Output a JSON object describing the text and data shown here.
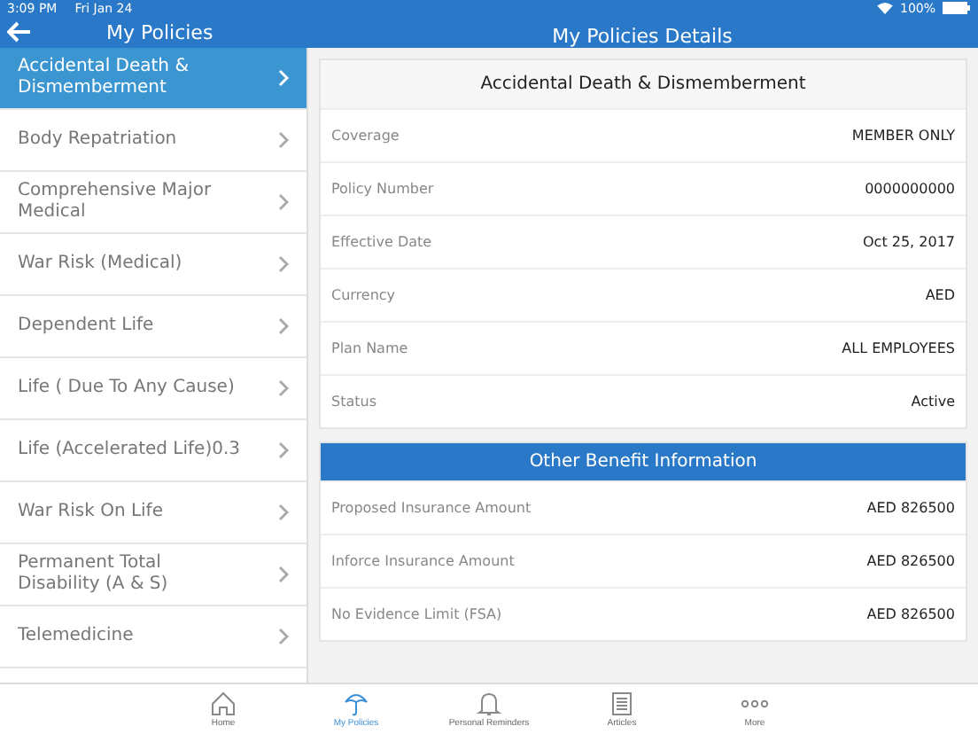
{
  "status_bar": {
    "time": "3:09 PM",
    "date": "Fri Jan 24",
    "battery": "100%"
  },
  "header": {
    "left_title": "My Policies",
    "right_title": "My Policies Details"
  },
  "sidebar": {
    "items": [
      {
        "label": "Accidental Death & Dismemberment",
        "selected": true
      },
      {
        "label": "Body Repatriation",
        "selected": false
      },
      {
        "label": "Comprehensive Major Medical",
        "selected": false
      },
      {
        "label": "War Risk (Medical)",
        "selected": false
      },
      {
        "label": "Dependent Life",
        "selected": false
      },
      {
        "label": "Life ( Due To Any Cause)",
        "selected": false
      },
      {
        "label": "Life (Accelerated Life)0.3",
        "selected": false
      },
      {
        "label": "War Risk On Life",
        "selected": false
      },
      {
        "label": "Permanent Total Disability (A & S)",
        "selected": false
      },
      {
        "label": "Telemedicine",
        "selected": false
      }
    ]
  },
  "details": {
    "title": "Accidental Death & Dismemberment",
    "rows": [
      {
        "label": "Coverage",
        "value": "MEMBER ONLY"
      },
      {
        "label": "Policy Number",
        "value": "0000000000"
      },
      {
        "label": "Effective Date",
        "value": "Oct 25, 2017"
      },
      {
        "label": "Currency",
        "value": "AED"
      },
      {
        "label": "Plan Name",
        "value": "ALL EMPLOYEES"
      },
      {
        "label": "Status",
        "value": "Active"
      }
    ]
  },
  "other_benefits": {
    "title": "Other Benefit Information",
    "rows": [
      {
        "label": "Proposed Insurance Amount",
        "value": "AED 826500"
      },
      {
        "label": "Inforce Insurance Amount",
        "value": "AED 826500"
      },
      {
        "label": "No Evidence Limit (FSA)",
        "value": "AED 826500"
      }
    ]
  },
  "tab_bar": [
    {
      "kind": "home",
      "label": "Home",
      "selected": false
    },
    {
      "kind": "umbrella",
      "label": "My Policies",
      "selected": true
    },
    {
      "kind": "bell",
      "label": "Personal Reminders",
      "selected": false
    },
    {
      "kind": "articles",
      "label": "Articles",
      "selected": false
    },
    {
      "kind": "more",
      "label": "More",
      "selected": false
    }
  ]
}
